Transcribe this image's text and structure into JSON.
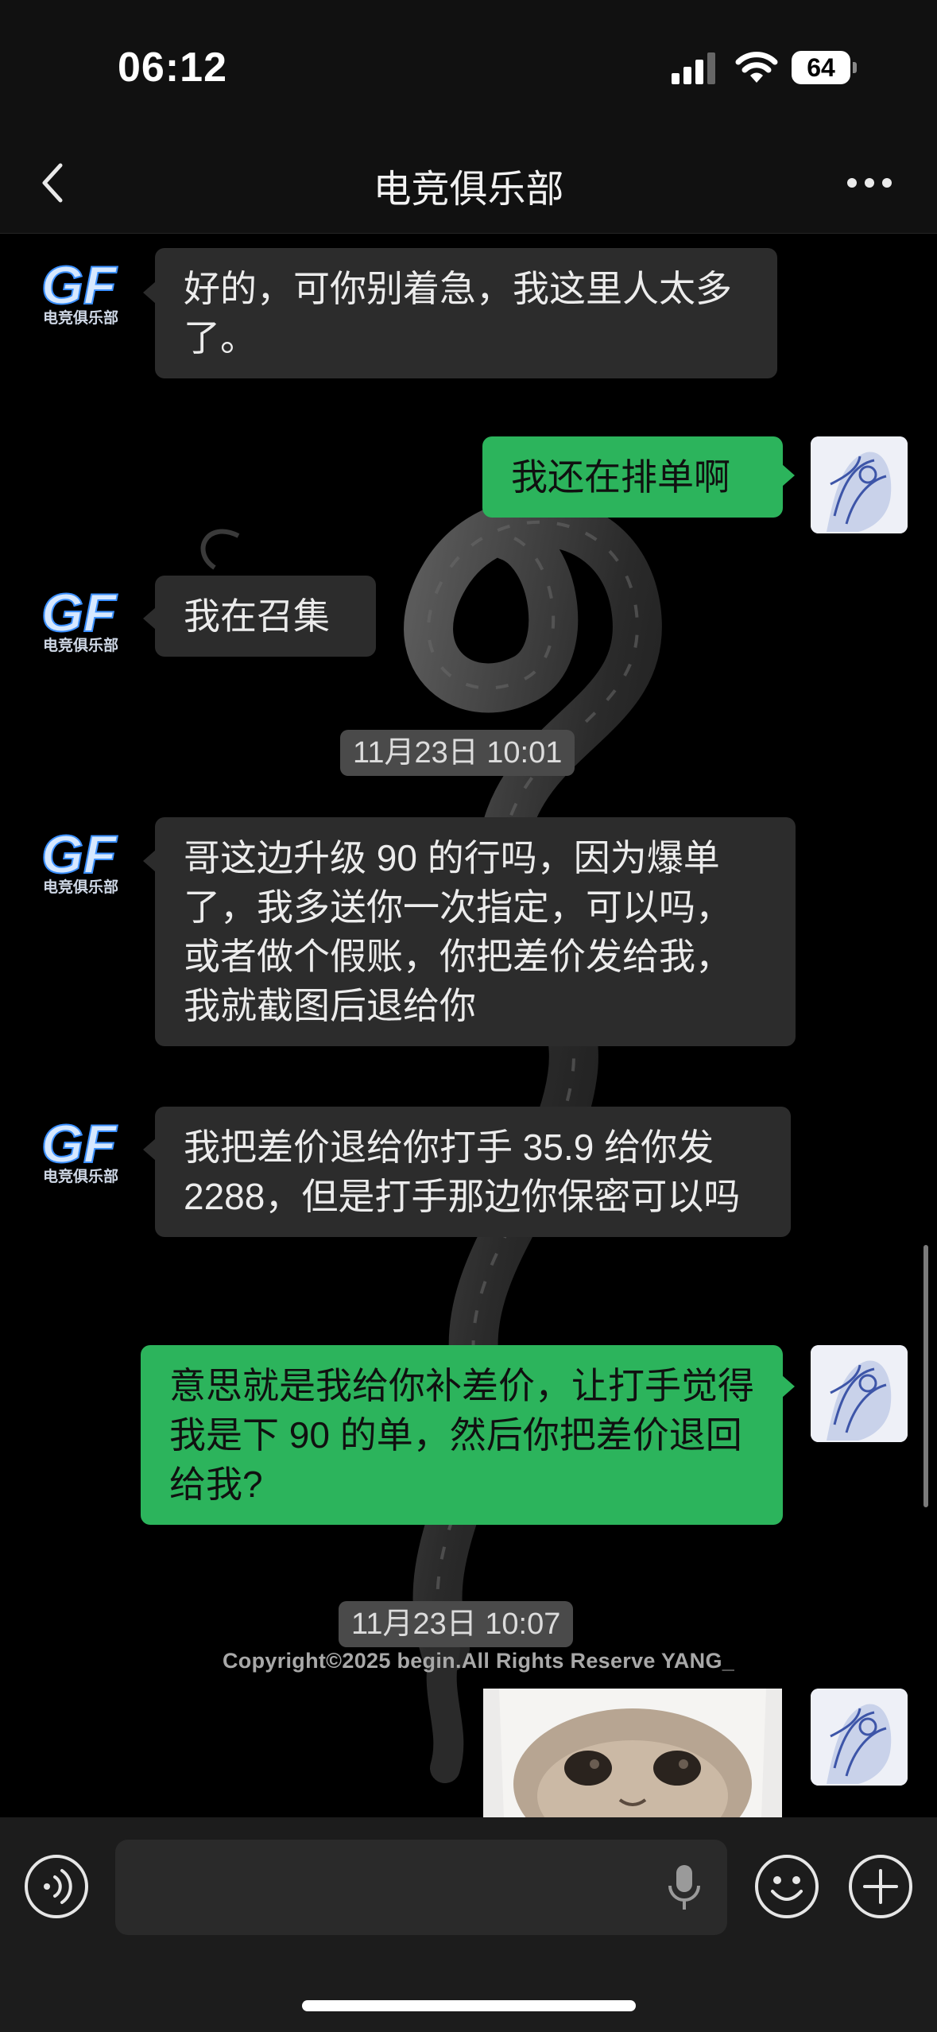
{
  "status_bar": {
    "time": "06:12",
    "battery": "64"
  },
  "nav": {
    "title": "电竞俱乐部"
  },
  "messages": [
    {
      "sender": "club",
      "text": "好的，可你别着急，我这里人太多了。"
    },
    {
      "sender": "me",
      "text": "我还在排单啊"
    },
    {
      "sender": "club",
      "text": "我在召集"
    },
    {
      "type": "timestamp",
      "text": "11月23日 10:01"
    },
    {
      "sender": "club",
      "text": "哥这边升级 90 的行吗，因为爆单了，我多送你一次指定，可以吗，或者做个假账，你把差价发给我，我就截图后退给你"
    },
    {
      "sender": "club",
      "text": "我把差价退给你打手 35.9 给你发 2288，但是打手那边你保密可以吗"
    },
    {
      "sender": "me",
      "text": "意思就是我给你补差价，让打手觉得我是下 90 的单，然后你把差价退回给我?"
    },
    {
      "type": "timestamp",
      "text": "11月23日 10:07"
    },
    {
      "sender": "me",
      "type": "image",
      "text": ""
    }
  ],
  "watermark": "Copyright©2025 begin.All Rights Reserve YANG_",
  "avatars": {
    "club_logo": "GF",
    "club_logo_sub": "电竞俱乐部"
  },
  "input": {
    "placeholder": ""
  },
  "colors": {
    "outgoing_bubble": "#2cb45c",
    "incoming_bubble": "#2c2c2c",
    "background": "#000000"
  }
}
